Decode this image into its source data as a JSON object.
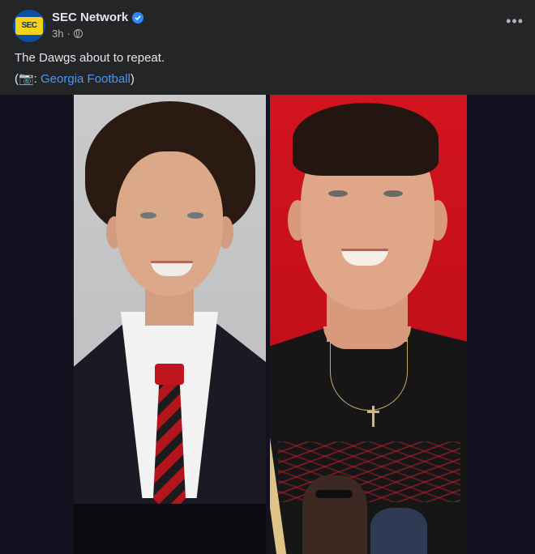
{
  "post": {
    "page_name": "SEC Network",
    "avatar_text": "SEC",
    "time": "3h",
    "time_separator": "·",
    "more_label": "•••",
    "text_line1": "The Dawgs about to repeat.",
    "credit_prefix": "(📷: ",
    "credit_link": "Georgia Football",
    "credit_suffix": ")"
  },
  "icons": {
    "verified": "verified-badge-icon",
    "privacy": "globe-icon",
    "more": "more-options-icon"
  },
  "colors": {
    "background": "#242526",
    "link": "#4599ff",
    "verified": "#2d88ff",
    "text_primary": "#e4e6eb",
    "text_secondary": "#b0b3b8"
  }
}
